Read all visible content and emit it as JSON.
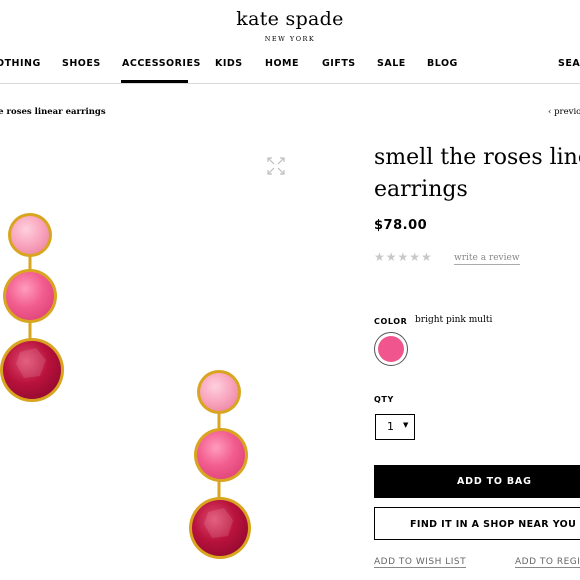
{
  "brand": {
    "name": "kate spade",
    "location": "NEW YORK"
  },
  "nav": {
    "items": [
      "OTHING",
      "SHOES",
      "ACCESSORIES",
      "KIDS",
      "HOME",
      "GIFTS",
      "SALE",
      "BLOG",
      "SEAR"
    ],
    "active": "ACCESSORIES"
  },
  "breadcrumb": "he roses linear earrings",
  "prev_link": "‹ previo",
  "product": {
    "title_line1": "smell the roses line",
    "title_line2": "earrings",
    "price": "$78.00",
    "rating_stars": "★★★★★",
    "rating_value": 0,
    "write_review": "write a review",
    "color_label": "COLOR",
    "color_value": "bright pink multi",
    "swatch_color": "#f0568d",
    "qty_label": "QTY",
    "qty_value": "1",
    "add_to_bag": "ADD TO BAG",
    "find_in_shop": "FIND IT IN A SHOP NEAR YOU +",
    "add_to_wishlist": "ADD TO WISH LIST",
    "add_to_registry": "ADD TO REGIS"
  },
  "icons": {
    "expand": "expand-icon",
    "dropdown": "caret-down-icon"
  },
  "colors": {
    "light_pink": "#f9a5be",
    "hot_pink": "#f25d8f",
    "raspberry": "#b8123c",
    "gold": "#d9a520"
  }
}
